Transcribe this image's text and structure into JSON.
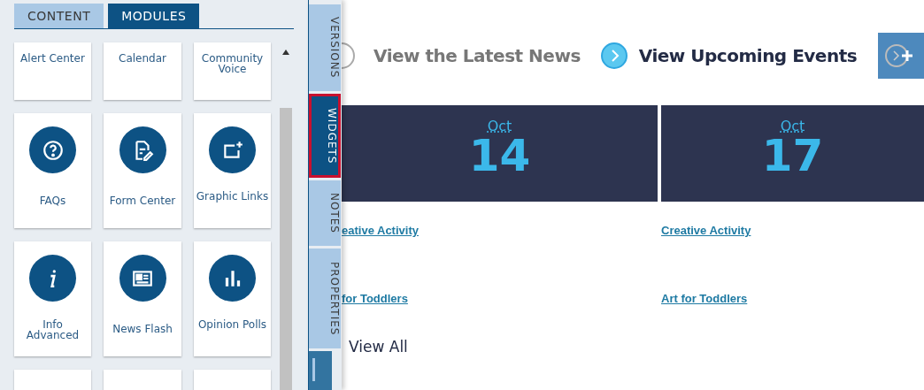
{
  "panel_tabs": [
    {
      "label": "CONTENT",
      "selected": false
    },
    {
      "label": "MODULES",
      "selected": true
    }
  ],
  "modules": [
    {
      "kind": "cut",
      "label": "Alert Center"
    },
    {
      "kind": "cut",
      "label": "Calendar"
    },
    {
      "kind": "cut",
      "label": "Community Voice"
    },
    {
      "kind": "faq",
      "label": "FAQs"
    },
    {
      "kind": "form",
      "label": "Form Center"
    },
    {
      "kind": "graphic",
      "label": "Graphic Links"
    },
    {
      "kind": "info",
      "label": "Info Advanced"
    },
    {
      "kind": "news",
      "label": "News Flash"
    },
    {
      "kind": "poll",
      "label": "Opinion Polls"
    },
    {
      "kind": "blank"
    },
    {
      "kind": "blank"
    },
    {
      "kind": "blank"
    }
  ],
  "side_tabs": [
    {
      "label": "VERSIONS",
      "selected": false
    },
    {
      "label": "WIDGETS",
      "selected": true
    },
    {
      "label": "NOTES",
      "selected": false
    },
    {
      "label": "PROPERTIES",
      "selected": false
    }
  ],
  "view_links": [
    {
      "label": "View the Latest News",
      "selected": false
    },
    {
      "label": "View Upcoming Events",
      "selected": true
    }
  ],
  "events": [
    {
      "month": "Oct",
      "day": "14",
      "links": [
        "eative Activity",
        "for Toddlers"
      ]
    },
    {
      "month": "Oct",
      "day": "17",
      "links": [
        "Creative Activity",
        "Art for Toddlers"
      ]
    }
  ],
  "view_all": "View All"
}
